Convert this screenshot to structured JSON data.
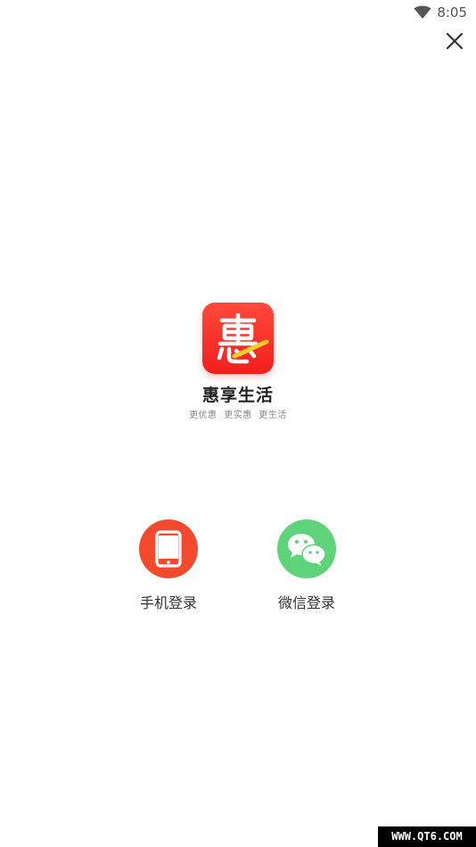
{
  "status_bar": {
    "time": "8:05",
    "wifi_icon": "wifi-icon"
  },
  "close_icon": "close-icon",
  "app": {
    "name": "惠享生活",
    "slogan": "更优惠 更实惠 更生活",
    "logo_char": "惠",
    "logo_color": "#f5281f"
  },
  "login_options": [
    {
      "label": "手机登录",
      "icon": "phone-icon",
      "color": "#f34a2d"
    },
    {
      "label": "微信登录",
      "icon": "wechat-icon",
      "color": "#5fd37a"
    }
  ],
  "watermark": "WWW.QT6.COM"
}
